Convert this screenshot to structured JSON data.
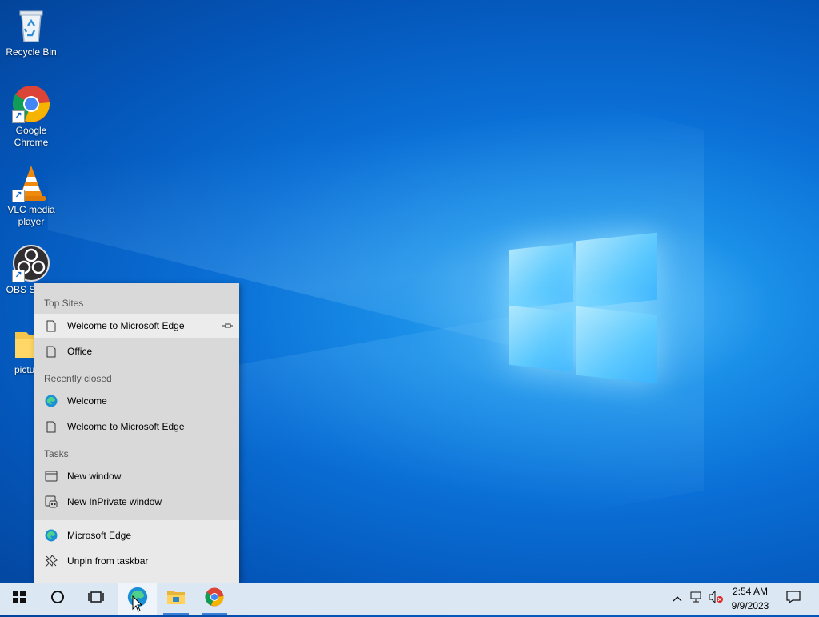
{
  "desktop": {
    "icons": [
      {
        "label": "Recycle Bin"
      },
      {
        "label": "Google Chrome"
      },
      {
        "label": "VLC media player"
      },
      {
        "label": "OBS Studio"
      },
      {
        "label": "pictures"
      }
    ]
  },
  "jumplist": {
    "top_sites_header": "Top Sites",
    "top_sites": [
      {
        "label": "Welcome to Microsoft Edge",
        "icon": "page-icon"
      },
      {
        "label": "Office",
        "icon": "page-icon"
      }
    ],
    "recently_closed_header": "Recently closed",
    "recently_closed": [
      {
        "label": "Welcome",
        "icon": "edge-icon"
      },
      {
        "label": "Welcome to Microsoft Edge",
        "icon": "page-icon"
      }
    ],
    "tasks_header": "Tasks",
    "tasks": [
      {
        "label": "New window",
        "icon": "window-icon"
      },
      {
        "label": "New InPrivate window",
        "icon": "inprivate-icon"
      }
    ],
    "bottom": [
      {
        "label": "Microsoft Edge",
        "icon": "edge-icon"
      },
      {
        "label": "Unpin from taskbar",
        "icon": "unpin-icon"
      }
    ]
  },
  "taskbar": {
    "apps": [
      "start-icon",
      "search-circle-icon",
      "task-view-icon",
      "edge-icon",
      "file-explorer-icon",
      "chrome-icon"
    ],
    "clock": {
      "time": "2:54 AM",
      "date": "9/9/2023"
    }
  },
  "colors": {
    "accent": "#3c7ed6",
    "taskbar": "#dbe7f3",
    "jumplist": "#d9d9d9"
  }
}
